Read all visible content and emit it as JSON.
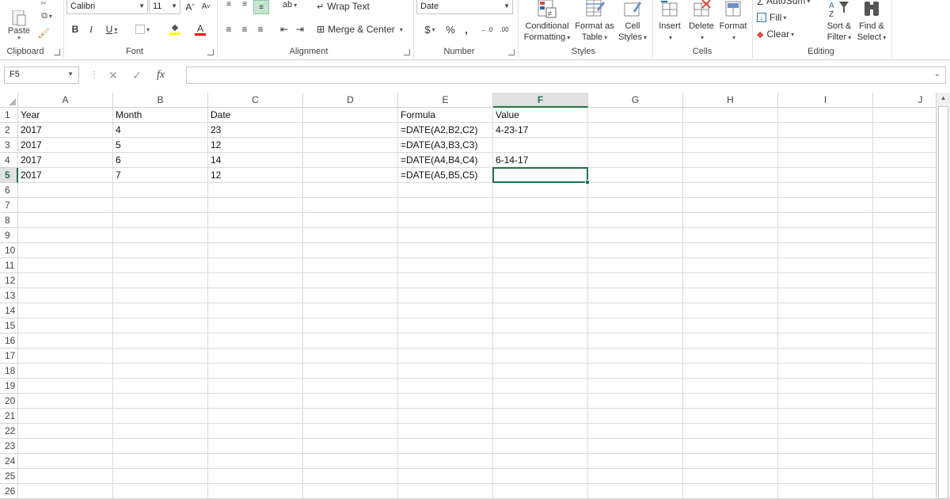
{
  "ribbon": {
    "clipboard": {
      "paste_label": "Paste",
      "group_label": "Clipboard"
    },
    "font": {
      "font_name": "Calibri",
      "font_size": "11",
      "bold": "B",
      "italic": "I",
      "underline": "U",
      "grow": "A",
      "shrink": "A",
      "font_color_letter": "A",
      "group_label": "Font"
    },
    "alignment": {
      "wrap_text": "Wrap Text",
      "merge_center": "Merge & Center",
      "group_label": "Alignment"
    },
    "number": {
      "format": "Date",
      "currency": "$",
      "percent": "%",
      "comma": ",",
      "group_label": "Number"
    },
    "styles": {
      "conditional_line1": "Conditional",
      "conditional_line2": "Formatting",
      "format_table_line1": "Format as",
      "format_table_line2": "Table",
      "cell_styles_line1": "Cell",
      "cell_styles_line2": "Styles",
      "group_label": "Styles"
    },
    "cells": {
      "insert": "Insert",
      "delete": "Delete",
      "format": "Format",
      "group_label": "Cells"
    },
    "editing": {
      "autosum": "AutoSum",
      "fill": "Fill",
      "clear": "Clear",
      "sort_line1": "Sort &",
      "sort_line2": "Filter",
      "find_line1": "Find &",
      "find_line2": "Select",
      "group_label": "Editing"
    }
  },
  "formula_bar": {
    "name_box": "F5",
    "fx": "fx",
    "cancel": "✕",
    "enter": "✓",
    "formula": ""
  },
  "columns": [
    "A",
    "B",
    "C",
    "D",
    "E",
    "F",
    "G",
    "H",
    "I",
    "J"
  ],
  "selected_column": "F",
  "rows": [
    "1",
    "2",
    "3",
    "4",
    "5",
    "6",
    "7",
    "8",
    "9",
    "10",
    "11",
    "12",
    "13",
    "14",
    "15",
    "16",
    "17",
    "18",
    "19",
    "20",
    "21",
    "22",
    "23",
    "24",
    "25",
    "26"
  ],
  "selected_row": "5",
  "cells": {
    "A1": "Year",
    "B1": "Month",
    "C1": "Date",
    "E1": "Formula",
    "F1": "Value",
    "A2": "2017",
    "B2": "4",
    "C2": "23",
    "E2": "=DATE(A2,B2,C2)",
    "F2": "4-23-17",
    "A3": "2017",
    "B3": "5",
    "C3": "12",
    "E3": "=DATE(A3,B3,C3)",
    "A4": "2017",
    "B4": "6",
    "C4": "14",
    "E4": "=DATE(A4,B4,C4)",
    "F4": "6-14-17",
    "A5": "2017",
    "B5": "7",
    "C5": "12",
    "E5": "=DATE(A5,B5,C5)"
  },
  "colors": {
    "accent": "#217346",
    "gridline": "#dadada",
    "header_border": "#d4d4d4"
  }
}
